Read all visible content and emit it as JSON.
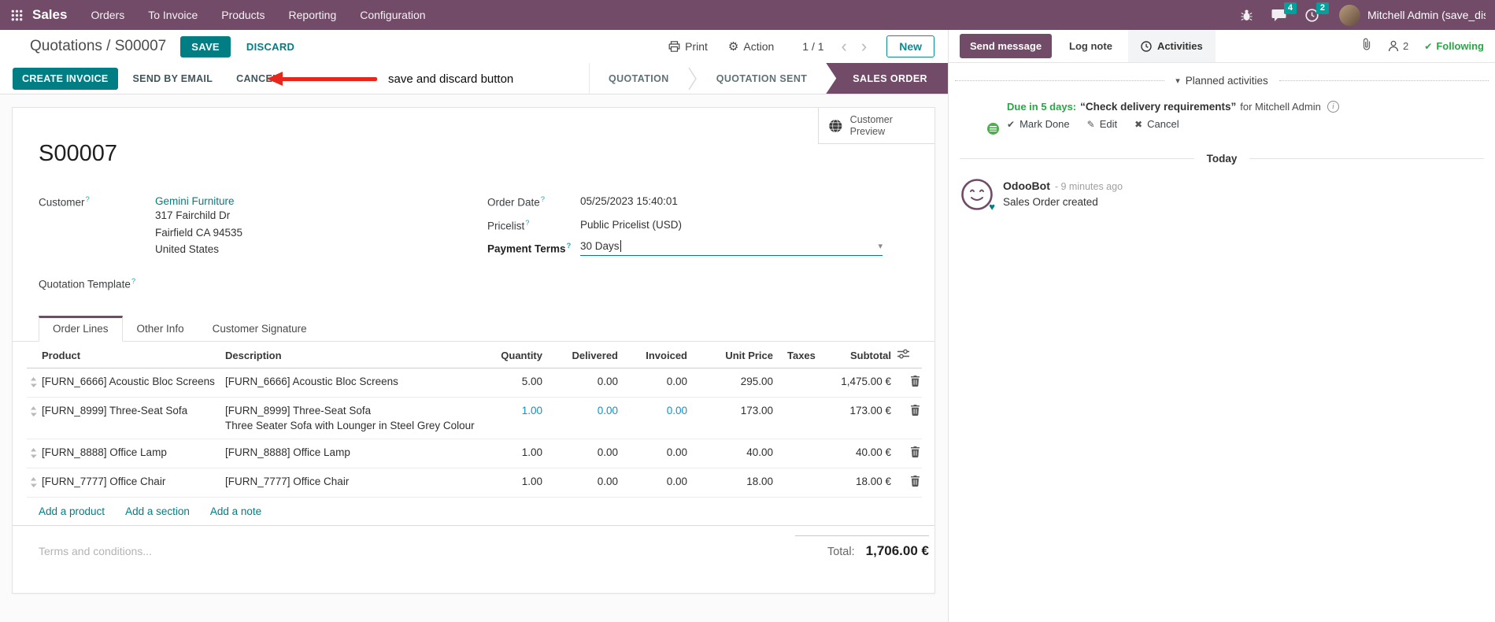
{
  "colors": {
    "brand_purple": "#714B67",
    "accent_teal": "#017e84",
    "badge_teal": "#00A09D",
    "success_green": "#28a745",
    "modified_blue": "#0d93c7",
    "annotation_red": "#e8271c"
  },
  "icons": {
    "gear": "⚙",
    "check": "✔",
    "pencil": "✎",
    "cross": "✖",
    "caret_down": "▾",
    "chevron_left": "‹",
    "chevron_right": "›",
    "heart": "♥",
    "info": "i"
  },
  "navbar": {
    "app_name": "Sales",
    "menus": [
      "Orders",
      "To Invoice",
      "Products",
      "Reporting",
      "Configuration"
    ],
    "message_badge": "4",
    "activity_badge": "2",
    "user_name": "Mitchell Admin (save_discard"
  },
  "control_panel": {
    "breadcrumb": "Quotations / S00007",
    "save": "SAVE",
    "discard": "DISCARD",
    "annotation": "save and discard button",
    "print": "Print",
    "action": "Action",
    "pager": "1 / 1",
    "new": "New"
  },
  "action_bar": {
    "create_invoice": "CREATE INVOICE",
    "send_by_email": "SEND BY EMAIL",
    "cancel": "CANCEL",
    "stages": [
      "QUOTATION",
      "QUOTATION SENT",
      "SALES ORDER"
    ],
    "active_stage": "SALES ORDER"
  },
  "sheet": {
    "customer_preview": "Customer Preview",
    "name": "S00007",
    "help_marker": "?",
    "customer_label": "Customer",
    "customer": "Gemini Furniture",
    "address": [
      "317 Fairchild Dr",
      "Fairfield CA 94535",
      "United States"
    ],
    "quotation_template_label": "Quotation Template",
    "order_date_label": "Order Date",
    "order_date": "05/25/2023 15:40:01",
    "pricelist_label": "Pricelist",
    "pricelist": "Public Pricelist (USD)",
    "payment_terms_label": "Payment Terms",
    "payment_terms": "30 Days"
  },
  "tabs": [
    "Order Lines",
    "Other Info",
    "Customer Signature"
  ],
  "order_lines": {
    "columns": [
      "Product",
      "Description",
      "Quantity",
      "Delivered",
      "Invoiced",
      "Unit Price",
      "Taxes",
      "Subtotal"
    ],
    "rows": [
      {
        "product": "[FURN_6666] Acoustic Bloc Screens",
        "description": "[FURN_6666] Acoustic Bloc Screens",
        "description2": "",
        "quantity": "5.00",
        "delivered": "0.00",
        "invoiced": "0.00",
        "unit_price": "295.00",
        "taxes": "",
        "subtotal": "1,475.00 €"
      },
      {
        "product": "[FURN_8999] Three-Seat Sofa",
        "description": "[FURN_8999] Three-Seat Sofa",
        "description2": "Three Seater Sofa with Lounger in Steel Grey Colour",
        "quantity": "1.00",
        "delivered": "0.00",
        "invoiced": "0.00",
        "unit_price": "173.00",
        "taxes": "",
        "subtotal": "173.00 €"
      },
      {
        "product": "[FURN_8888] Office Lamp",
        "description": "[FURN_8888] Office Lamp",
        "description2": "",
        "quantity": "1.00",
        "delivered": "0.00",
        "invoiced": "0.00",
        "unit_price": "40.00",
        "taxes": "",
        "subtotal": "40.00 €"
      },
      {
        "product": "[FURN_7777] Office Chair",
        "description": "[FURN_7777] Office Chair",
        "description2": "",
        "quantity": "1.00",
        "delivered": "0.00",
        "invoiced": "0.00",
        "unit_price": "18.00",
        "taxes": "",
        "subtotal": "18.00 €"
      }
    ],
    "add_product": "Add a product",
    "add_section": "Add a section",
    "add_note": "Add a note",
    "total_label": "Total:",
    "total": "1,706.00 €",
    "terms_placeholder": "Terms and conditions..."
  },
  "chatter": {
    "send_message": "Send message",
    "log_note": "Log note",
    "activities": "Activities",
    "follower_count": "2",
    "following": "Following",
    "planned_header": "Planned activities",
    "activity": {
      "due": "Due in 5 days:",
      "summary": "“Check delivery requirements”",
      "assignee": "for Mitchell Admin",
      "mark_done": "Mark Done",
      "edit": "Edit",
      "cancel": "Cancel"
    },
    "today": "Today",
    "message": {
      "author": "OdooBot",
      "time": "- 9 minutes ago",
      "body": "Sales Order created"
    }
  }
}
